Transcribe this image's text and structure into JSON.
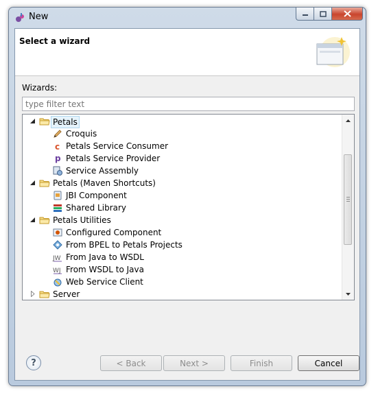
{
  "window": {
    "title": "New"
  },
  "header": {
    "title": "Select a wizard"
  },
  "wizards": {
    "label": "Wizards:",
    "filter_placeholder": "type filter text",
    "filter_value": "",
    "tree": [
      {
        "label": "Petals",
        "level": 0,
        "expanded": true,
        "selected": true,
        "icon": "folder-icon"
      },
      {
        "label": "Croquis",
        "level": 1,
        "icon": "pencil-icon"
      },
      {
        "label": "Petals Service Consumer",
        "level": 1,
        "icon": "consumer-c-icon"
      },
      {
        "label": "Petals Service Provider",
        "level": 1,
        "icon": "provider-p-icon"
      },
      {
        "label": "Service Assembly",
        "level": 1,
        "icon": "service-assembly-icon"
      },
      {
        "label": "Petals (Maven Shortcuts)",
        "level": 0,
        "expanded": true,
        "icon": "folder-icon"
      },
      {
        "label": "JBI Component",
        "level": 1,
        "icon": "jbi-component-icon"
      },
      {
        "label": "Shared Library",
        "level": 1,
        "icon": "shared-library-icon"
      },
      {
        "label": "Petals Utilities",
        "level": 0,
        "expanded": true,
        "icon": "folder-icon"
      },
      {
        "label": "Configured Component",
        "level": 1,
        "icon": "configured-component-icon"
      },
      {
        "label": "From BPEL to Petals Projects",
        "level": 1,
        "icon": "bpel-icon"
      },
      {
        "label": "From Java to WSDL",
        "level": 1,
        "icon": "java-to-wsdl-icon"
      },
      {
        "label": "From WSDL to Java",
        "level": 1,
        "icon": "wsdl-to-java-icon"
      },
      {
        "label": "Web Service Client",
        "level": 1,
        "icon": "web-service-client-icon"
      },
      {
        "label": "Server",
        "level": 0,
        "expanded": false,
        "icon": "folder-icon"
      }
    ]
  },
  "buttons": {
    "back": "< Back",
    "next": "Next >",
    "finish": "Finish",
    "cancel": "Cancel"
  },
  "colors": {
    "selection_bg": "#e5f3fb",
    "selection_border": "#aed6ef",
    "close_red": "#c9452d"
  }
}
